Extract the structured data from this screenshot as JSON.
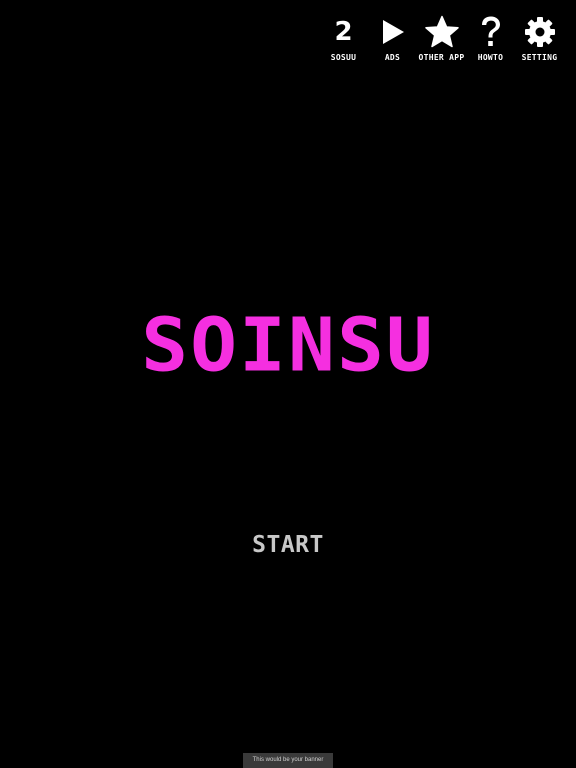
{
  "menu": {
    "sosuu": {
      "count": "2",
      "label": "SOSUU",
      "icon": "number-counter"
    },
    "ads": {
      "label": "ADS",
      "icon": "play-icon"
    },
    "other_app": {
      "label": "OTHER APP",
      "icon": "star-icon"
    },
    "howto": {
      "label": "HOWTO",
      "icon": "question-icon"
    },
    "setting": {
      "label": "SETTING",
      "icon": "gear-icon"
    }
  },
  "title": "SOINSU",
  "start_label": "START",
  "banner_text": "This would be your banner",
  "colors": {
    "background": "#000000",
    "title": "#f52fe0",
    "start": "#c8c8c8",
    "icons": "#ffffff",
    "banner_bg": "#3a3a3a"
  }
}
